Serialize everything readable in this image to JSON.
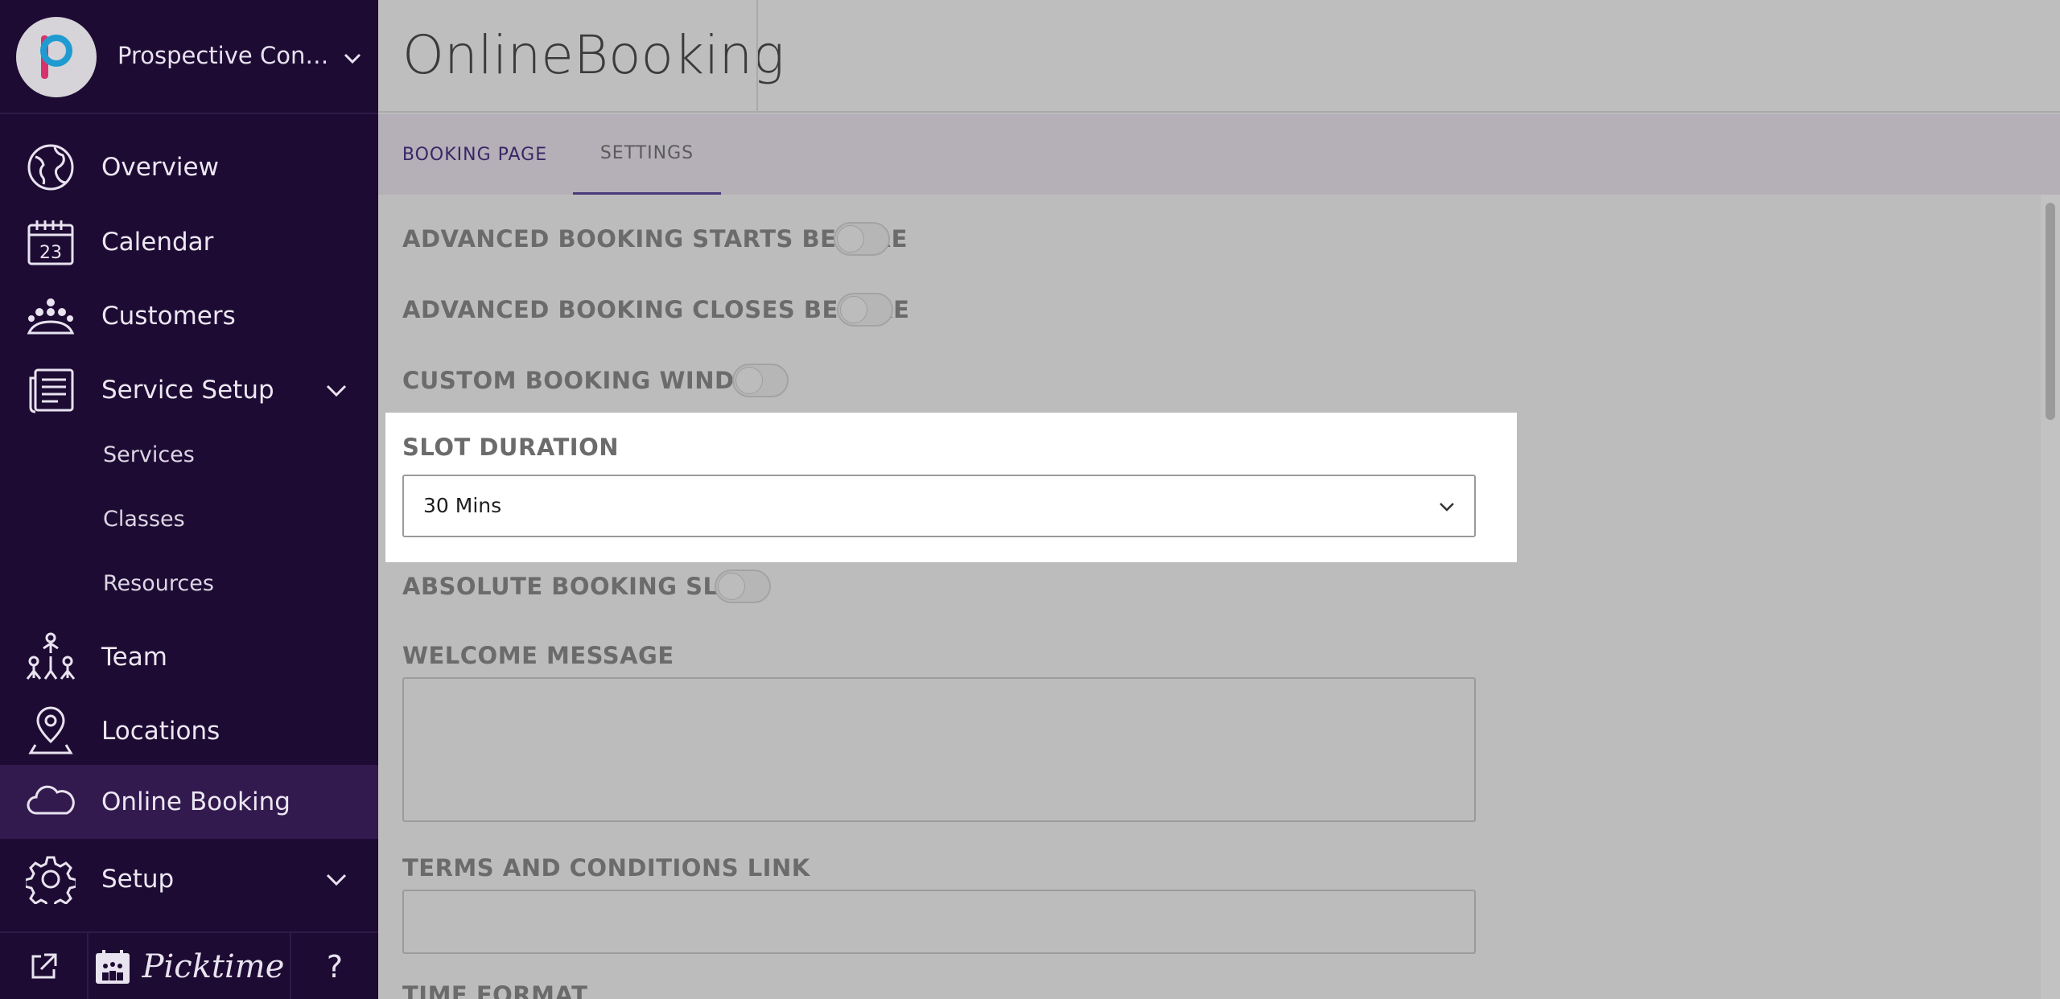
{
  "sidebar": {
    "org_name": "Prospective Consul...",
    "items": [
      {
        "label": "Overview",
        "icon": "globe-icon"
      },
      {
        "label": "Calendar",
        "icon": "calendar-icon",
        "icon_text": "23"
      },
      {
        "label": "Customers",
        "icon": "customers-icon"
      },
      {
        "label": "Service Setup",
        "icon": "service-setup-icon"
      },
      {
        "label": "Team",
        "icon": "team-icon"
      },
      {
        "label": "Locations",
        "icon": "location-pin-icon"
      },
      {
        "label": "Online Booking",
        "icon": "cloud-icon",
        "active": true
      },
      {
        "label": "Setup",
        "icon": "gear-icon"
      }
    ],
    "sub_items": [
      {
        "label": "Services"
      },
      {
        "label": "Classes"
      },
      {
        "label": "Resources"
      }
    ],
    "footer": {
      "external_link_icon": "external-link-icon",
      "brand": "Picktime",
      "help": "?"
    }
  },
  "header": {
    "title": "OnlineBooking"
  },
  "tabs": [
    {
      "label": "BOOKING PAGE"
    },
    {
      "label": "SETTINGS",
      "active": true
    }
  ],
  "settings": {
    "advanced_booking_starts_before": {
      "label": "ADVANCED BOOKING STARTS BEFORE",
      "on": false
    },
    "advanced_booking_closes_before": {
      "label": "ADVANCED BOOKING CLOSES BEFORE",
      "on": false
    },
    "custom_booking_window": {
      "label": "CUSTOM BOOKING WINDOW",
      "on": false
    },
    "slot_duration": {
      "label": "SLOT DURATION",
      "value": "30 Mins"
    },
    "absolute_booking_slot": {
      "label": "ABSOLUTE BOOKING SLOT",
      "on": false
    },
    "welcome_message": {
      "label": "WELCOME MESSAGE",
      "value": ""
    },
    "terms_link": {
      "label": "TERMS AND CONDITIONS LINK",
      "value": ""
    },
    "time_format": {
      "label": "TIME FORMAT"
    }
  },
  "colors": {
    "sidebar_bg": "#1e0b34",
    "sidebar_active": "#321a4f",
    "accent": "#3a2666"
  }
}
